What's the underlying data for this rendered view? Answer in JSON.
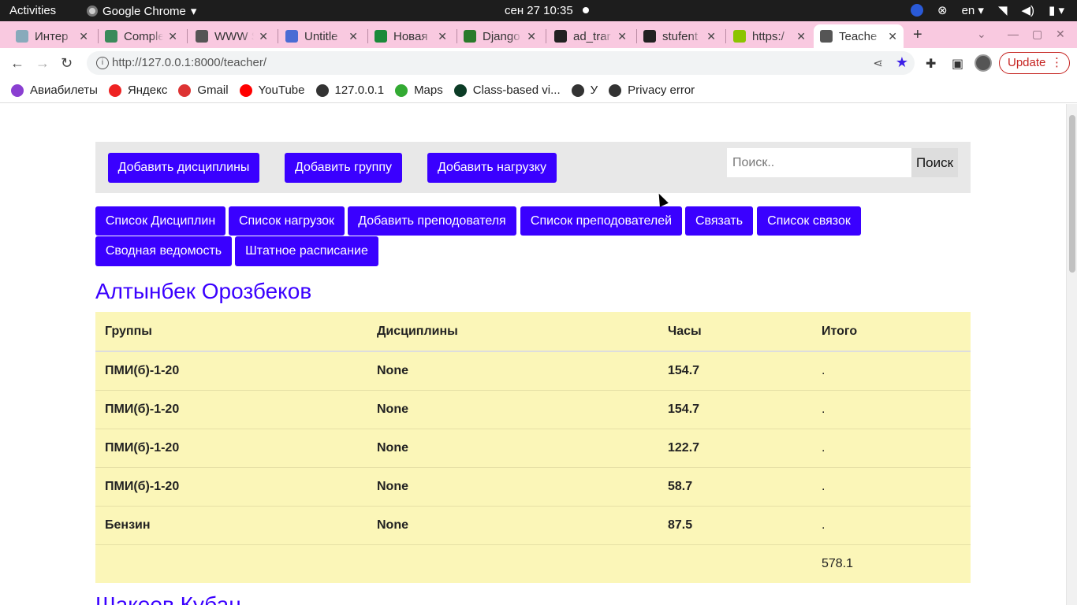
{
  "gnome": {
    "activities": "Activities",
    "app_name": "Google Chrome",
    "clock": "сен 27  10:35",
    "lang": "en"
  },
  "tabs": [
    {
      "title": "Интер",
      "color": "#8ab"
    },
    {
      "title": "Comple",
      "color": "#3a8a5a"
    },
    {
      "title": "WWW S",
      "color": "#555"
    },
    {
      "title": "Untitle",
      "color": "#4a6cd4"
    },
    {
      "title": "Новая",
      "color": "#1a8a3a"
    },
    {
      "title": "Django",
      "color": "#2a7a2a"
    },
    {
      "title": "ad_trar",
      "color": "#222"
    },
    {
      "title": "stufent",
      "color": "#222"
    },
    {
      "title": "https:/",
      "color": "#8bc400"
    },
    {
      "title": "Teache",
      "color": "#555"
    }
  ],
  "address": {
    "url": "http://127.0.0.1:8000/teacher/",
    "update_label": "Update"
  },
  "bookmarks": [
    {
      "label": "Авиабилеты",
      "color": "#8a3fd1"
    },
    {
      "label": "Яндекс",
      "color": "#e22"
    },
    {
      "label": "Gmail",
      "color": "#d33"
    },
    {
      "label": "YouTube",
      "color": "#f00"
    },
    {
      "label": "127.0.0.1",
      "color": "#333"
    },
    {
      "label": "Maps",
      "color": "#3a3"
    },
    {
      "label": "Class-based vi...",
      "color": "#0c3c26"
    },
    {
      "label": "У",
      "color": "#333"
    },
    {
      "label": "Privacy error",
      "color": "#333"
    }
  ],
  "topnav": {
    "add_disciplines": "Добавить дисциплины",
    "add_group": "Добавить группу",
    "add_load": "Добавить нагрузку",
    "search_placeholder": "Поиск..",
    "search_button": "Поиск"
  },
  "menu": {
    "disciplines_list": "Список Дисциплин",
    "loads_list": "Список нагрузок",
    "add_teacher": "Добавить преподователя",
    "teachers_list": "Список преподователей",
    "link": "Связать",
    "links_list": "Список связок",
    "summary": "Сводная ведомость",
    "staff_schedule": "Штатное расписание"
  },
  "teacher": {
    "name": "Алтынбек Орозбеков",
    "next_name": "Шакеев Кубан"
  },
  "table": {
    "headers": [
      "Группы",
      "Дисциплины",
      "Часы",
      "Итого"
    ],
    "rows": [
      {
        "group": "ПМИ(б)-1-20",
        "discipline": "None",
        "hours": "154.7",
        "total": "."
      },
      {
        "group": "ПМИ(б)-1-20",
        "discipline": "None",
        "hours": "154.7",
        "total": "."
      },
      {
        "group": "ПМИ(б)-1-20",
        "discipline": "None",
        "hours": "122.7",
        "total": "."
      },
      {
        "group": "ПМИ(б)-1-20",
        "discipline": "None",
        "hours": "58.7",
        "total": "."
      },
      {
        "group": "Бензин",
        "discipline": "None",
        "hours": "87.5",
        "total": "."
      }
    ],
    "sum": "578.1"
  }
}
